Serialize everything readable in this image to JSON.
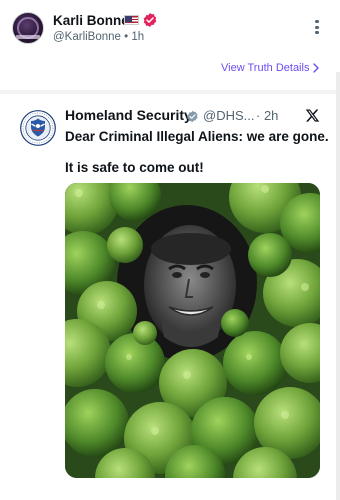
{
  "author": {
    "name": "Karli Bonne’",
    "handle_time": "@KarliBonne • 1h",
    "flag_icon": "us-flag-icon",
    "badge_icon": "verified-badge-icon",
    "badge_color": "#e0245e"
  },
  "header": {
    "view_link": "View Truth Details",
    "link_color": "#6d4df0"
  },
  "quoted": {
    "name": "Homeland Security",
    "handle": "@DHS...",
    "time": "· 2h",
    "line1": "Dear Criminal Illegal Aliens: we are gone.",
    "line2": "It is safe to come out!",
    "badge_color": "#829aab",
    "source_icon": "x-logo-icon",
    "avatar_icon": "dhs-seal-icon"
  },
  "media": {
    "description_icon": "hedge-face-image",
    "foliage_color": "#6fa33a"
  }
}
